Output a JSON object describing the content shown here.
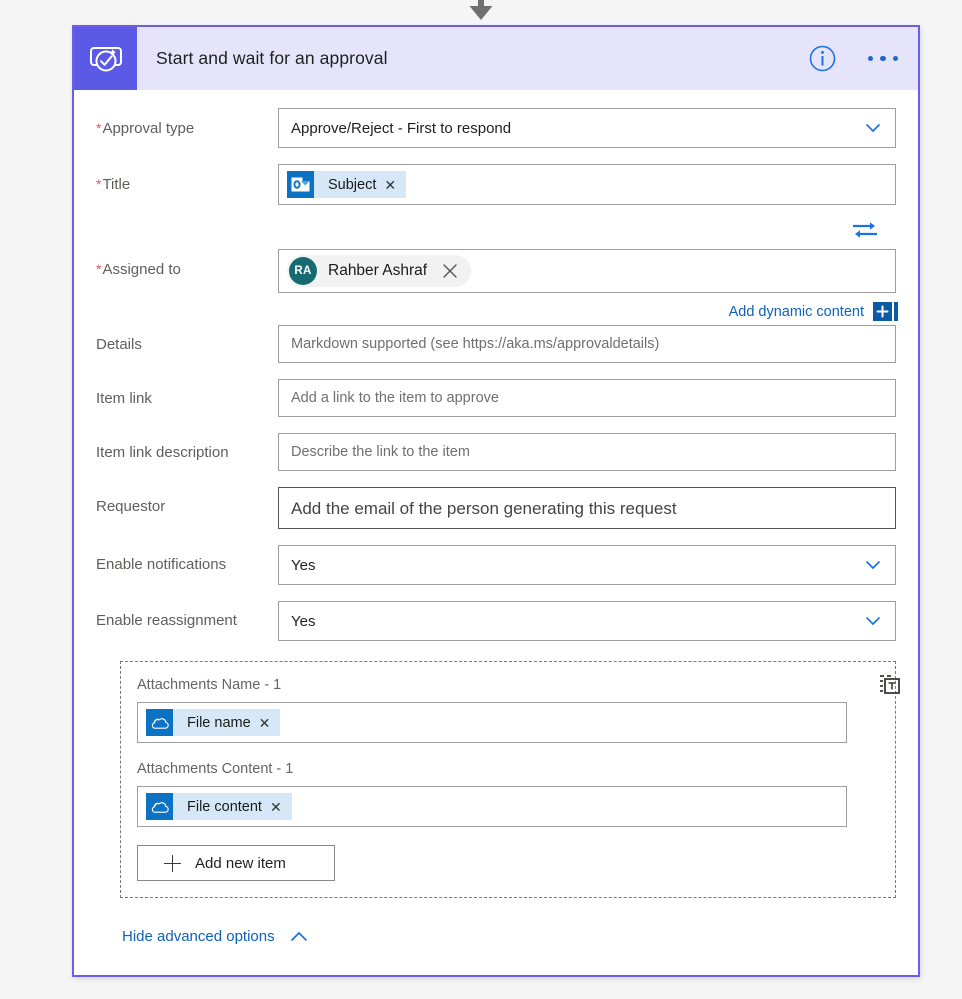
{
  "connector": {
    "arrow_icon": "down-arrow-icon",
    "add_step_icon": "add-circle-icon"
  },
  "card": {
    "accent_color": "#6b5fe8",
    "header": {
      "icon": "approvals-icon",
      "icon_tile_color": "#5a5ae6",
      "background": "#e6e4fb",
      "title": "Start and wait for an approval",
      "info_icon": "info-circle-icon",
      "more_icon": "ellipsis-icon"
    },
    "fields": {
      "approval_type": {
        "label": "Approval type",
        "required": true,
        "value": "Approve/Reject - First to respond",
        "chevron_icon": "chevron-down-icon"
      },
      "title": {
        "label": "Title",
        "required": true,
        "token": {
          "label": "Subject",
          "icon": "outlook-icon",
          "remove_icon": "remove-token-icon"
        }
      },
      "swap": {
        "icon": "swap-arrows-icon"
      },
      "assigned_to": {
        "label": "Assigned to",
        "required": true,
        "person": {
          "initials": "RA",
          "name": "Rahber Ashraf",
          "avatar_color": "#166a72",
          "remove_icon": "remove-person-icon"
        }
      },
      "dynamic_content": {
        "link_label": "Add dynamic content",
        "plus_icon": "add-plus-icon"
      },
      "details": {
        "label": "Details",
        "required": false,
        "placeholder": "Markdown supported (see https://aka.ms/approvaldetails)"
      },
      "item_link": {
        "label": "Item link",
        "required": false,
        "placeholder": "Add a link to the item to approve"
      },
      "item_link_description": {
        "label": "Item link description",
        "required": false,
        "placeholder": "Describe the link to the item"
      },
      "requestor": {
        "label": "Requestor",
        "required": false,
        "placeholder": "Add the email of the person generating this request"
      },
      "enable_notifications": {
        "label": "Enable notifications",
        "required": false,
        "value": "Yes",
        "chevron_icon": "chevron-down-icon"
      },
      "enable_reassignment": {
        "label": "Enable reassignment",
        "required": false,
        "value": "Yes",
        "chevron_icon": "chevron-down-icon"
      }
    },
    "attachments": {
      "text_mode_icon": "switch-to-text-mode-icon",
      "name": {
        "label": "Attachments Name - 1",
        "token": {
          "label": "File name",
          "icon": "onedrive-icon",
          "remove_icon": "remove-token-icon"
        }
      },
      "content": {
        "label": "Attachments Content - 1",
        "token": {
          "label": "File content",
          "icon": "onedrive-icon",
          "remove_icon": "remove-token-icon"
        }
      },
      "add_new_item": {
        "label": "Add new item",
        "plus_icon": "add-plus-icon"
      }
    },
    "advanced": {
      "label": "Hide advanced options",
      "chevron_icon": "chevron-up-icon"
    }
  }
}
